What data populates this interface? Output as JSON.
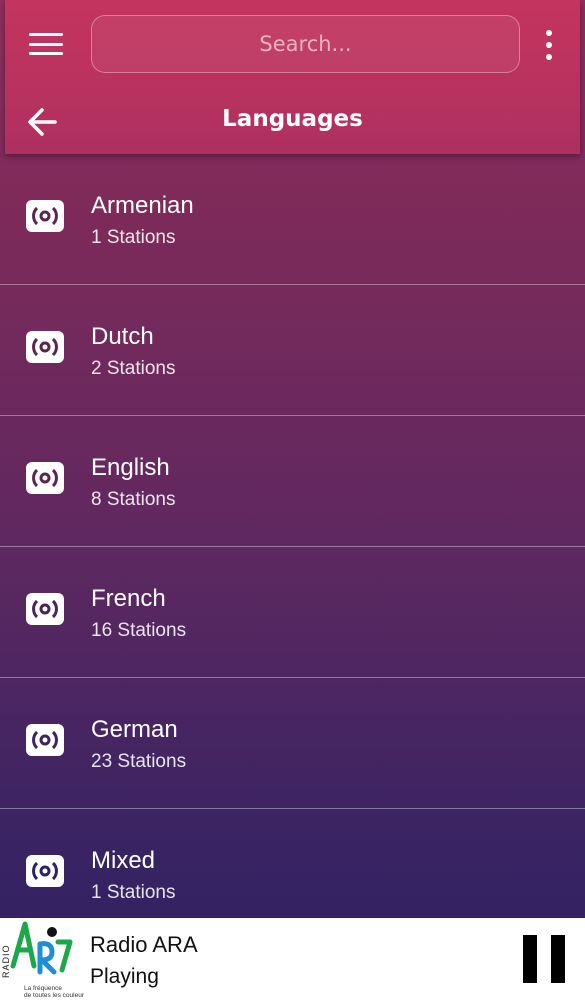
{
  "appbar": {
    "search_placeholder": "Search...",
    "title": "Languages",
    "menu_icon": "hamburger-menu-icon",
    "more_icon": "vertical-dots-icon",
    "back_icon": "arrow-left-icon",
    "color": "#c4345f"
  },
  "languages": [
    {
      "name": "Armenian",
      "count": "1 Stations"
    },
    {
      "name": "Dutch",
      "count": "2 Stations"
    },
    {
      "name": "English",
      "count": "8 Stations"
    },
    {
      "name": "French",
      "count": "16 Stations"
    },
    {
      "name": "German",
      "count": "23 Stations"
    },
    {
      "name": "Mixed",
      "count": "1 Stations"
    }
  ],
  "row_icon": "radio-broadcast-icon",
  "player": {
    "station": "Radio ARA",
    "status": "Playing",
    "logo_text": "RADIO ARA",
    "logo_tagline": "La fréquence de toutes les couleurs",
    "pause_icon": "pause-icon"
  }
}
